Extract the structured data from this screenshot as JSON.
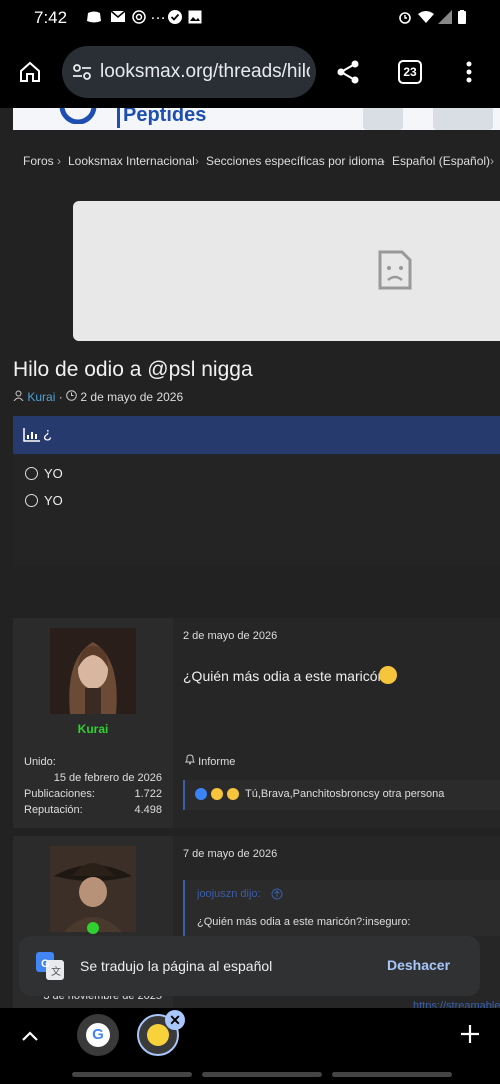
{
  "status": {
    "time": "7:42",
    "dots": "…"
  },
  "browser": {
    "url": "looksmax.org/threads/hilo-d",
    "tab_count": "23"
  },
  "banner": {
    "brand": "Peptides"
  },
  "breadcrumbs": [
    "Foros",
    "Looksmax Internacional",
    "Secciones específicas por idioma",
    "Español (Español)"
  ],
  "thread": {
    "title": "Hilo de odio a @psl nigga",
    "author": "Kurai",
    "date": "2 de mayo de 2026"
  },
  "poll": {
    "header": "¿",
    "options": [
      "YO",
      "YO"
    ]
  },
  "posts": [
    {
      "username": "Kurai",
      "joined_label": "Unido:",
      "joined": "15 de febrero de 2026",
      "posts_label": "Publicaciones:",
      "posts": "1.722",
      "rep_label": "Reputación:",
      "rep": "4.498",
      "date": "2 de mayo de 2026",
      "text": "¿Quién más odia a este maricón?",
      "report": "Informe",
      "reactions": "Tú,Brava,Panchitosbroncsy otra persona"
    },
    {
      "date": "7 de mayo de 2026",
      "quote_author": "joojuszn dijo:",
      "quote_text": "¿Quién más odia a este maricón?:inseguro:",
      "joined_partial": "3 de noviembre de 2025",
      "link_partial": "https://streamable"
    }
  ],
  "snackbar": {
    "message": "Se tradujo la página al español",
    "action": "Deshacer"
  }
}
